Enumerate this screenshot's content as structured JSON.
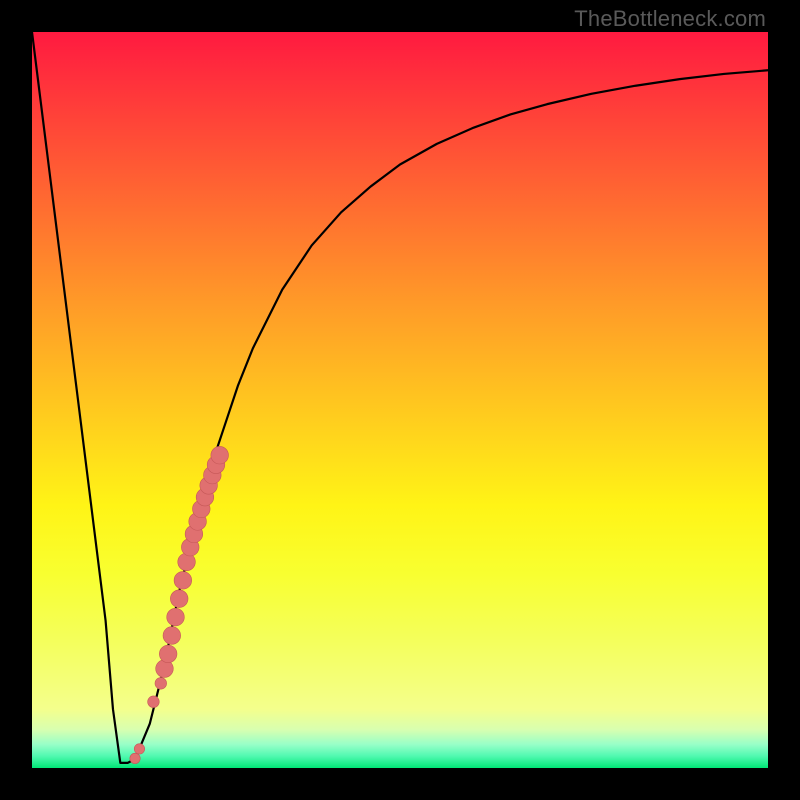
{
  "watermark": "TheBottleneck.com",
  "colors": {
    "frame_border": "#000000",
    "curve_stroke": "#000000",
    "marker_fill": "#e07070",
    "marker_stroke": "#c65858"
  },
  "chart_data": {
    "type": "line",
    "title": "",
    "xlabel": "",
    "ylabel": "",
    "xlim": [
      0,
      100
    ],
    "ylim": [
      0,
      100
    ],
    "grid": false,
    "series": [
      {
        "name": "bottleneck-curve",
        "x": [
          0,
          2,
          4,
          6,
          8,
          10,
          11,
          12,
          13,
          14,
          16,
          18,
          20,
          22,
          24,
          26,
          28,
          30,
          34,
          38,
          42,
          46,
          50,
          55,
          60,
          65,
          70,
          76,
          82,
          88,
          94,
          100
        ],
        "y": [
          100,
          84,
          68,
          52,
          36,
          20,
          8,
          0.7,
          0.7,
          1.2,
          6,
          14,
          24,
          32,
          40,
          46,
          52,
          57,
          65,
          71,
          75.5,
          79,
          82,
          84.8,
          87,
          88.8,
          90.2,
          91.6,
          92.7,
          93.6,
          94.3,
          94.8
        ]
      }
    ],
    "markers": [
      {
        "name": "highlighted-segment",
        "shape": "circle",
        "x": [
          14.0,
          14.6,
          16.5,
          17.5,
          18.0,
          18.5,
          19.0,
          19.5,
          20.0,
          20.5,
          21.0,
          21.5,
          22.0,
          22.5,
          23.0,
          23.5,
          24.0,
          24.5,
          25.0,
          25.5
        ],
        "y": [
          1.3,
          2.6,
          9.0,
          11.5,
          13.5,
          15.5,
          18.0,
          20.5,
          23.0,
          25.5,
          28.0,
          30.0,
          31.8,
          33.5,
          35.2,
          36.8,
          38.4,
          39.8,
          41.2,
          42.5
        ]
      }
    ]
  }
}
